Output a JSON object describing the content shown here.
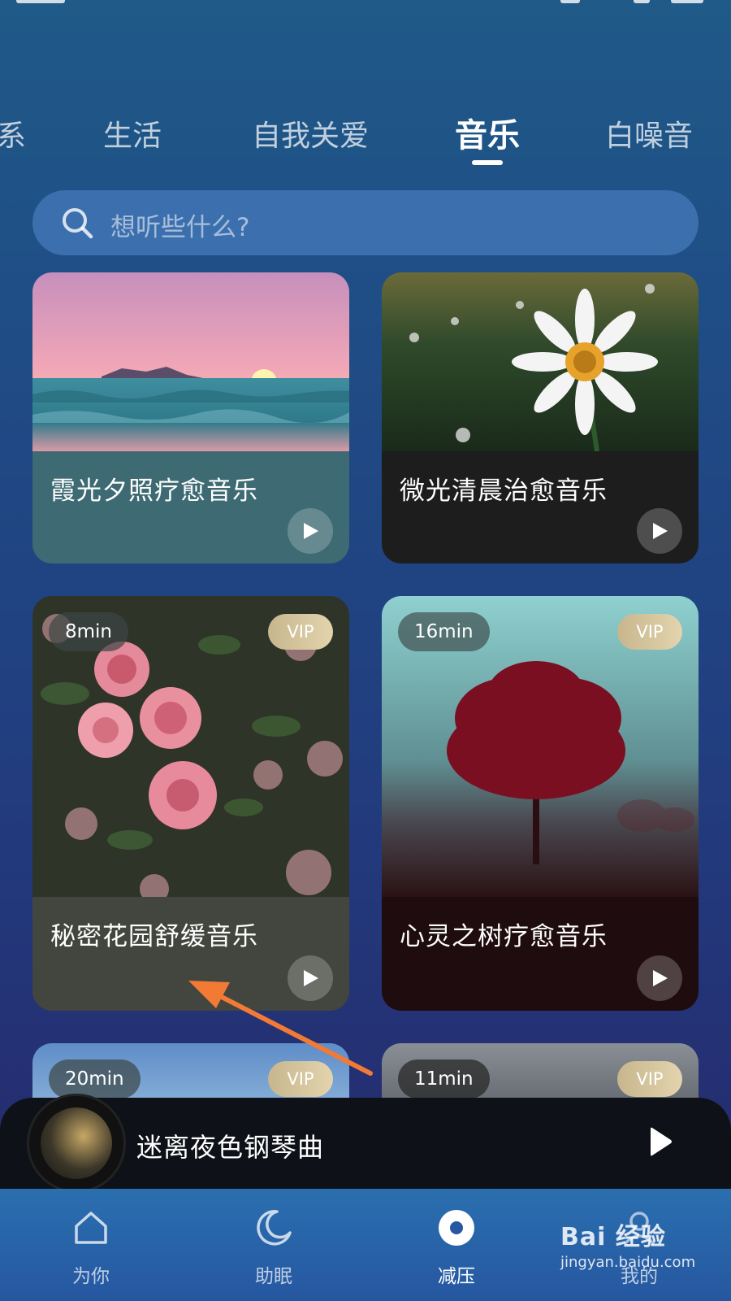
{
  "tabs": [
    {
      "label": "系"
    },
    {
      "label": "生活"
    },
    {
      "label": "自我关爱"
    },
    {
      "label": "音乐",
      "active": true
    },
    {
      "label": "白噪音"
    }
  ],
  "search": {
    "placeholder": "想听些什么?"
  },
  "cards": [
    {
      "title": "霞光夕照疗愈音乐",
      "image": "sunset-over-ocean-waves"
    },
    {
      "title": "微光清晨治愈音乐",
      "image": "daisy-in-meadow"
    },
    {
      "title": "秘密花园舒缓音乐",
      "duration": "8min",
      "badge": "VIP",
      "image": "pink-roses"
    },
    {
      "title": "心灵之树疗愈音乐",
      "duration": "16min",
      "badge": "VIP",
      "image": "red-tree-in-fog"
    },
    {
      "duration": "20min",
      "badge": "VIP",
      "image": "sky-gradient"
    },
    {
      "duration": "11min",
      "badge": "VIP",
      "image": "grey-sky"
    }
  ],
  "player": {
    "track": "迷离夜色钢琴曲"
  },
  "nav": [
    {
      "label": "为你",
      "icon": "home-icon"
    },
    {
      "label": "助眠",
      "icon": "moon-icon"
    },
    {
      "label": "减压",
      "icon": "record-icon",
      "active": true
    },
    {
      "label": "我的",
      "icon": "profile-icon"
    }
  ],
  "watermark": {
    "brand": "Bai 经验",
    "url": "jingyan.baidu.com"
  },
  "colors": {
    "annotation_arrow": "#f27a35",
    "vip_badge": "#d6c79f"
  }
}
